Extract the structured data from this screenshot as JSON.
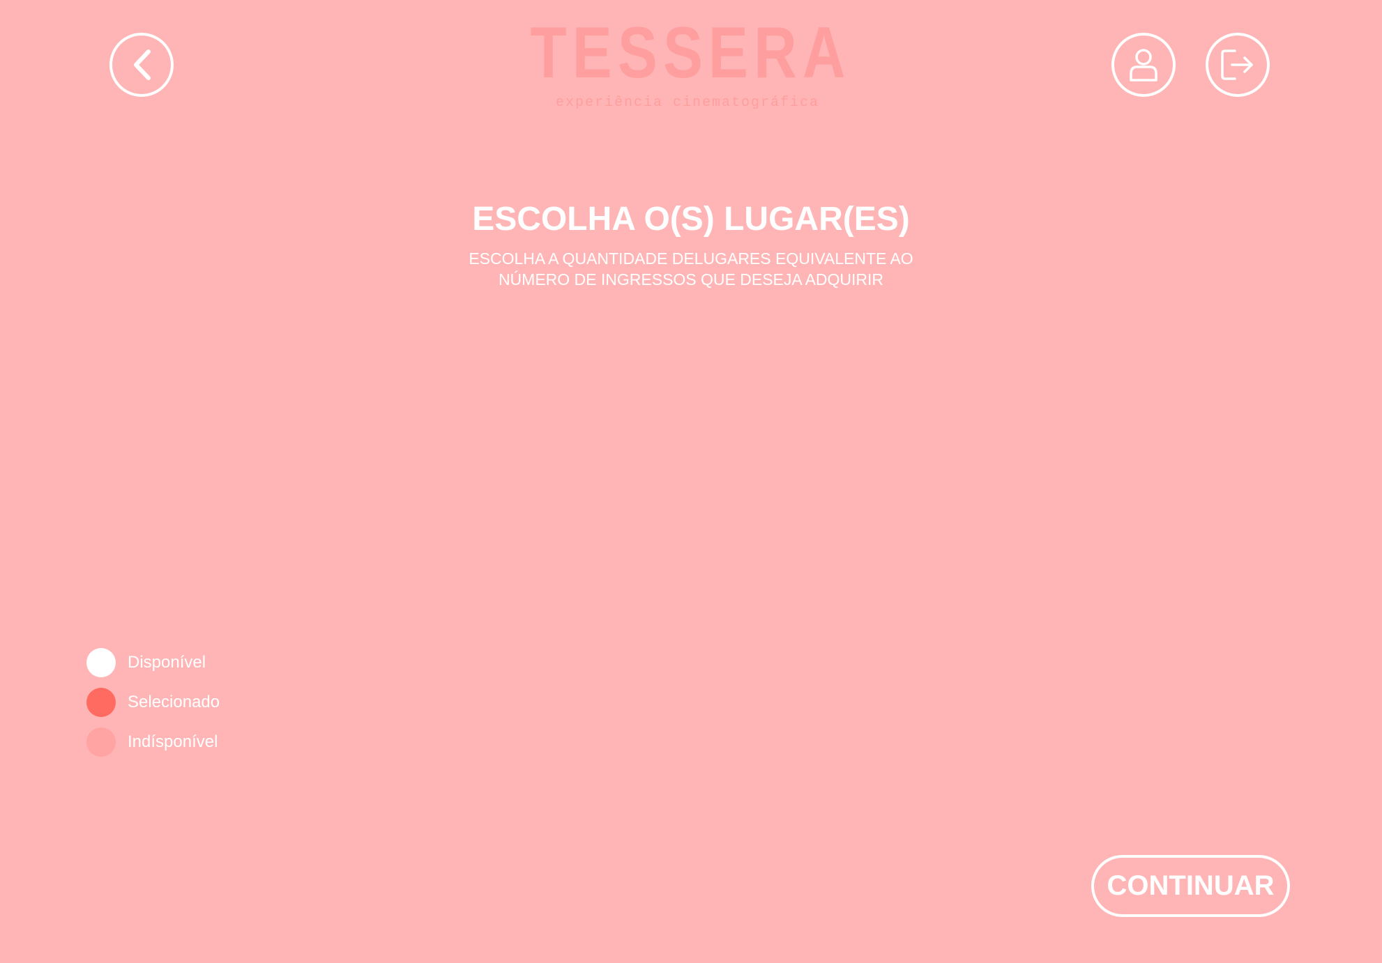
{
  "header": {
    "logo_title": "TESSERA",
    "logo_subtitle": "experiência cinematográfica",
    "back_icon": "chevron-left-icon",
    "profile_icon": "user-icon",
    "logout_icon": "logout-icon"
  },
  "main": {
    "title": "ESCOLHA O(S) LUGAR(ES)",
    "subtitle_line1": "ESCOLHA A QUANTIDADE DELUGARES EQUIVALENTE AO",
    "subtitle_line2": "NÚMERO DE INGRESSOS QUE DESEJA ADQUIRIR"
  },
  "legend": {
    "items": [
      {
        "label": "Disponível",
        "color": "#FFFFFF"
      },
      {
        "label": "Selecionado",
        "color": "#FF6B61"
      },
      {
        "label": "Indísponível",
        "color": "#FFA3A3"
      }
    ]
  },
  "actions": {
    "continue_label": "CONTINUAR"
  },
  "theme": {
    "background": "#FFB5B5",
    "logo_color": "#FF9E9E"
  }
}
